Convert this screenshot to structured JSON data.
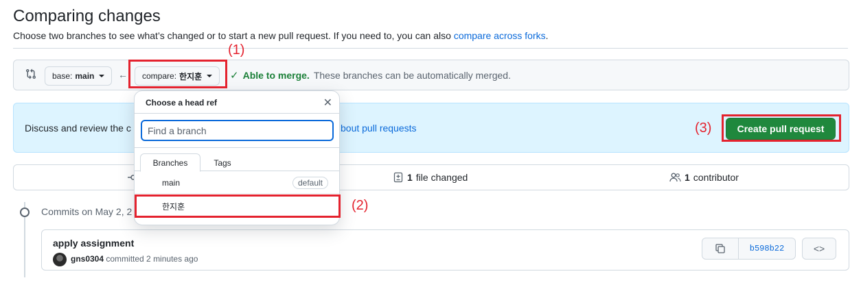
{
  "page": {
    "title": "Comparing changes",
    "subtitle": "Choose two branches to see what’s changed or to start a new pull request. If you need to, you can also ",
    "subtitle_link": "compare across forks",
    "subtitle_end": "."
  },
  "compare_bar": {
    "base_prefix": "base: ",
    "base_branch": "main",
    "compare_prefix": "compare: ",
    "compare_branch": "한지훈",
    "merge_ok": "Able to merge.",
    "merge_text": "These branches can be automatically merged."
  },
  "discuss": {
    "text": "Discuss and review the c",
    "link": "bout pull requests",
    "create_button": "Create pull request"
  },
  "stats": {
    "files_count": "1",
    "files_label": "file changed",
    "contributors_count": "1",
    "contributors_label": "contributor"
  },
  "commits": {
    "header": "Commits on May 2, 2",
    "items": [
      {
        "title": "apply assignment",
        "author": "gns0304",
        "meta": "committed 2 minutes ago",
        "sha": "b598b22"
      }
    ]
  },
  "dropdown": {
    "title": "Choose a head ref",
    "filter_placeholder": "Find a branch",
    "tabs": [
      "Branches",
      "Tags"
    ],
    "branches": [
      {
        "name": "main",
        "badge": "default"
      },
      {
        "name": "한지훈",
        "badge": ""
      }
    ]
  },
  "annotations": {
    "one": "(1)",
    "two": "(2)",
    "three": "(3)",
    "color": "#e4222e"
  },
  "icons": {
    "compare": "git-compare-icon",
    "arrow": "arrow-left-icon",
    "check": "check-icon",
    "close": "x-icon",
    "diff": "file-diff-icon",
    "people": "people-icon",
    "commit": "git-commit-icon",
    "copy": "copy-icon",
    "code": "code-icon"
  }
}
